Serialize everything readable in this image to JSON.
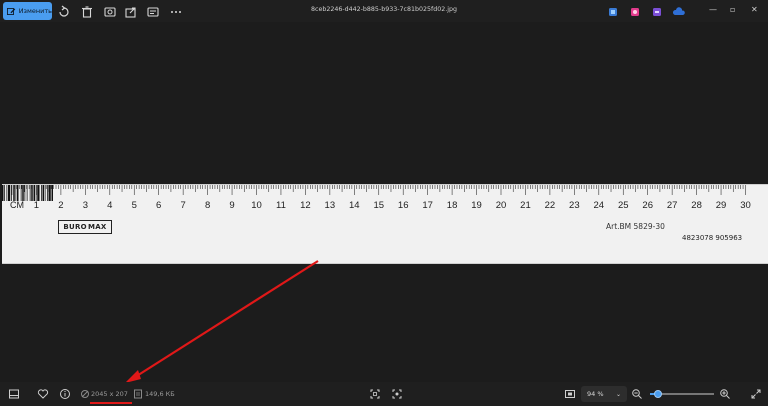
{
  "toolbar": {
    "edit_label": "Изменить",
    "filename": "8ceb2246-d442-b885-b933-7c81b025fd02.jpg"
  },
  "ruler": {
    "unit_label": "CM",
    "numbers": [
      "1",
      "2",
      "3",
      "4",
      "5",
      "6",
      "7",
      "8",
      "9",
      "10",
      "11",
      "12",
      "13",
      "14",
      "15",
      "16",
      "17",
      "18",
      "19",
      "20",
      "21",
      "22",
      "23",
      "24",
      "25",
      "26",
      "27",
      "28",
      "29",
      "30"
    ],
    "brand_left": "BURO",
    "brand_right": "MAX",
    "article": "Art.BM 5829-30",
    "barcode_number": "4823078 905963"
  },
  "statusbar": {
    "dimensions": "2045 x 207",
    "file_size": "149,6 КБ",
    "zoom_value": "94 %",
    "zoom_level": 0.12
  },
  "colors": {
    "accent": "#4a9df0",
    "annotation_red": "#e01818"
  }
}
